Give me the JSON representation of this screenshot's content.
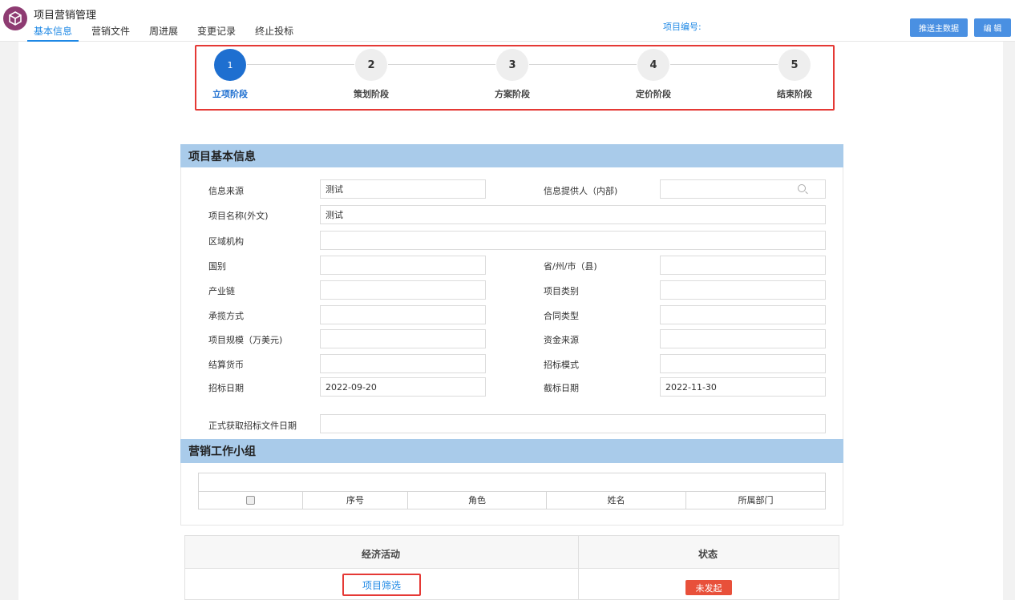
{
  "header": {
    "app_title": "项目营销管理",
    "tabs": [
      {
        "label": "基本信息",
        "active": true
      },
      {
        "label": "营销文件"
      },
      {
        "label": "周进展"
      },
      {
        "label": "变更记录"
      },
      {
        "label": "终止投标"
      }
    ],
    "project_no_label": "项目编号:",
    "push_button": "推送主数据",
    "edit_button": "编 辑",
    "logo_icon": "cube-icon",
    "logo_color": "#8e3b72"
  },
  "stepper": {
    "current": 1,
    "steps": [
      {
        "num": "1",
        "label": "立项阶段"
      },
      {
        "num": "2",
        "label": "策划阶段"
      },
      {
        "num": "3",
        "label": "方案阶段"
      },
      {
        "num": "4",
        "label": "定价阶段"
      },
      {
        "num": "5",
        "label": "结束阶段"
      }
    ]
  },
  "basic_info": {
    "title": "项目基本信息",
    "fields": {
      "info_source": {
        "label": "信息来源",
        "value": "测试"
      },
      "info_provider": {
        "label": "信息提供人（内部)",
        "value": ""
      },
      "project_name_foreign": {
        "label": "项目名称(外文)",
        "value": "测试"
      },
      "region_org": {
        "label": "区域机构",
        "value": ""
      },
      "country": {
        "label": "国别",
        "value": ""
      },
      "province": {
        "label": "省/州/市（县)",
        "value": ""
      },
      "industry_chain": {
        "label": "产业链",
        "value": ""
      },
      "project_category": {
        "label": "项目类别",
        "value": ""
      },
      "contract_method": {
        "label": "承揽方式",
        "value": ""
      },
      "contract_type": {
        "label": "合同类型",
        "value": ""
      },
      "project_scale": {
        "label": "项目规模（万美元)",
        "value": ""
      },
      "fund_source": {
        "label": "资金来源",
        "value": ""
      },
      "settlement_currency": {
        "label": "结算货币",
        "value": ""
      },
      "bidding_mode": {
        "label": "招标模式",
        "value": ""
      },
      "bid_date": {
        "label": "招标日期",
        "value": "2022-09-20"
      },
      "deadline_date": {
        "label": "截标日期",
        "value": "2022-11-30"
      },
      "formal_doc_date": {
        "label": "正式获取招标文件日期",
        "value": ""
      }
    }
  },
  "team": {
    "title": "营销工作小组",
    "columns": [
      "序号",
      "角色",
      "姓名",
      "所属部门"
    ]
  },
  "activities": {
    "columns": [
      "经济活动",
      "状态"
    ],
    "rows": [
      {
        "activity": "项目筛选",
        "status": "未发起",
        "status_color": "#e8503a"
      }
    ]
  },
  "colors": {
    "accent": "#1e88e5",
    "step_active": "#1e6fd0",
    "section_header": "#a9cbea",
    "highlight_border": "#e53935"
  }
}
